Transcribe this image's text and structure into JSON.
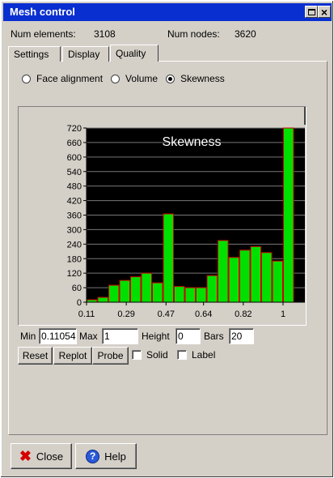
{
  "window": {
    "title": "Mesh control"
  },
  "info": {
    "elements_label": "Num elements:",
    "elements_value": "3108",
    "nodes_label": "Num nodes:",
    "nodes_value": "3620"
  },
  "tabs": [
    {
      "label": "Settings"
    },
    {
      "label": "Display"
    },
    {
      "label": "Quality"
    }
  ],
  "radios": [
    {
      "label": "Face alignment",
      "checked": false
    },
    {
      "label": "Volume",
      "checked": false
    },
    {
      "label": "Skewness",
      "checked": true
    }
  ],
  "controls": {
    "min_label": "Min",
    "min_value": "0.11054",
    "max_label": "Max",
    "max_value": "1",
    "height_label": "Height",
    "height_value": "0",
    "bars_label": "Bars",
    "bars_value": "20",
    "reset_label": "Reset",
    "replot_label": "Replot",
    "probe_label": "Probe",
    "solid_label": "Solid",
    "label_label": "Label"
  },
  "footer": {
    "close_label": "Close",
    "help_label": "Help"
  },
  "chart_data": {
    "type": "bar",
    "title": "Skewness",
    "x_tick_labels": [
      "0.11",
      "0.29",
      "0.47",
      "0.64",
      "0.82",
      "1"
    ],
    "y_ticks": [
      0,
      60,
      120,
      180,
      240,
      300,
      360,
      420,
      480,
      540,
      600,
      660,
      720
    ],
    "ylim": [
      0,
      720
    ],
    "xlim": [
      0.11,
      1.0
    ],
    "bar_color": "#00e000",
    "bar_edge_color": "#cc0000",
    "background": "#000000",
    "grid": true,
    "values": [
      10,
      20,
      70,
      90,
      105,
      120,
      80,
      365,
      65,
      60,
      60,
      110,
      255,
      185,
      215,
      230,
      205,
      170,
      720,
      0
    ]
  }
}
